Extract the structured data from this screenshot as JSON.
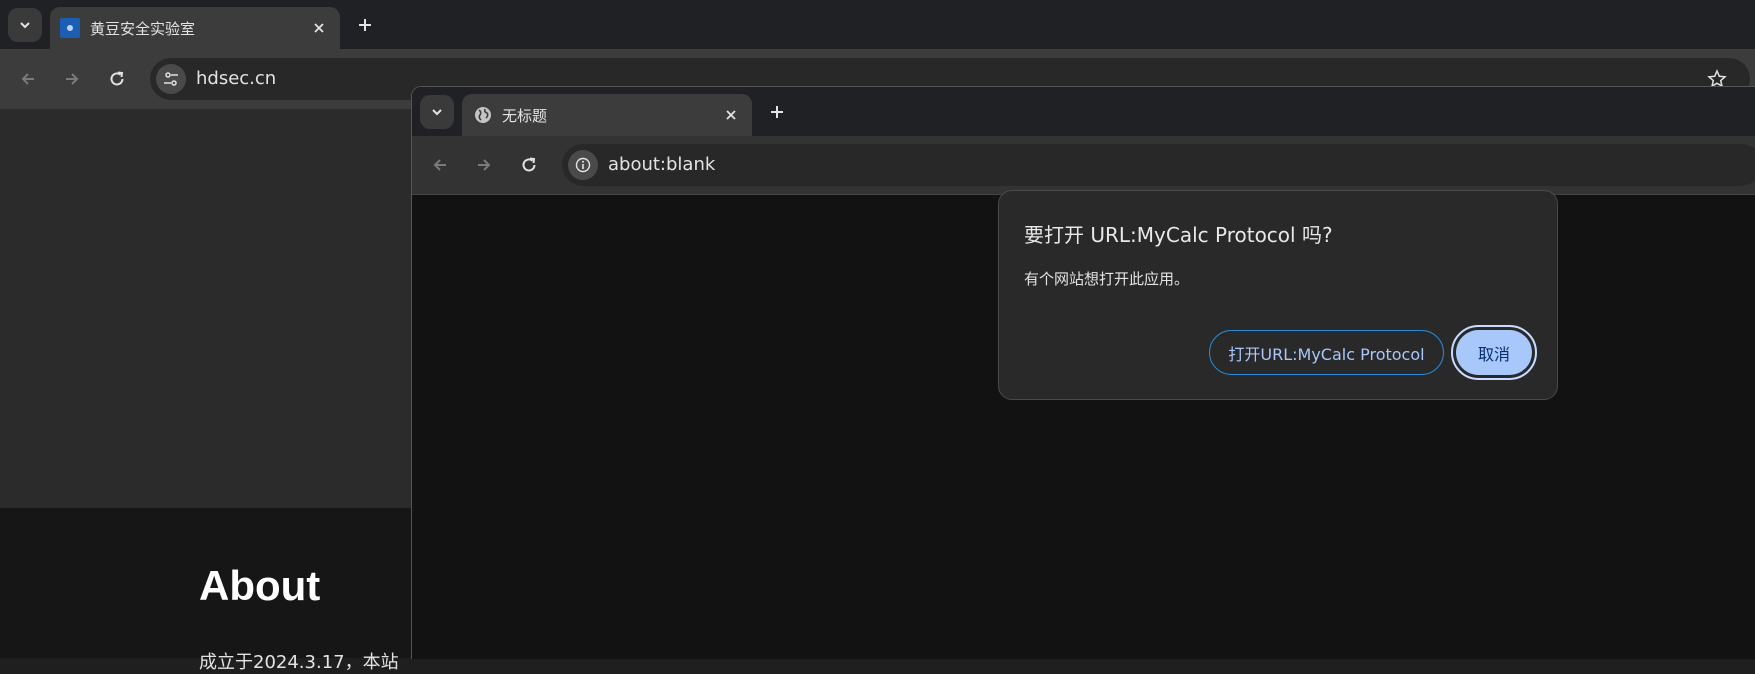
{
  "back_window": {
    "tab": {
      "title": "黄豆安全实验室",
      "favicon": "hdsec-logo-icon"
    },
    "address": {
      "url": "hdsec.cn"
    },
    "page": {
      "heading": "About",
      "snippet": "成立于2024.3.17，本站"
    }
  },
  "front_window": {
    "tab": {
      "title": "无标题",
      "favicon": "globe-icon"
    },
    "address": {
      "url": "about:blank"
    }
  },
  "dialog": {
    "title": "要打开 URL:MyCalc Protocol 吗?",
    "message": "有个网站想打开此应用。",
    "open_button": "打开URL:MyCalc Protocol",
    "cancel_button": "取消"
  },
  "colors": {
    "accent": "#a8c7fa",
    "dialog_bg": "#292929",
    "toolbar_bg": "#3c3c3c",
    "tabstrip_bg": "#202124"
  }
}
